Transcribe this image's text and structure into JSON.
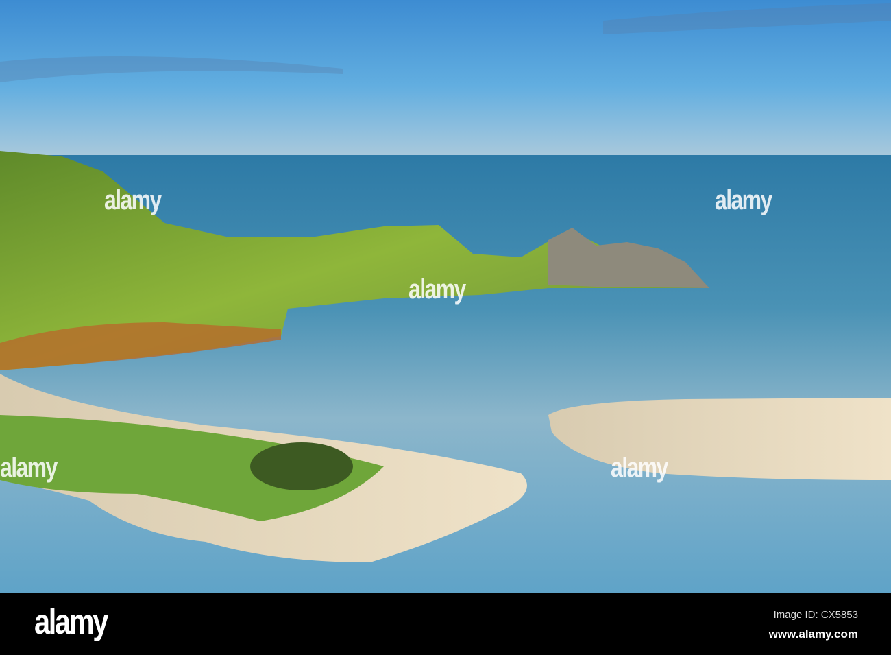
{
  "photo": {
    "subject": "coastal bay headland with sand spits"
  },
  "watermark": "alamy",
  "footer": {
    "logo": "alamy",
    "image_id": "Image ID: CX5853",
    "website": "www.alamy.com"
  }
}
